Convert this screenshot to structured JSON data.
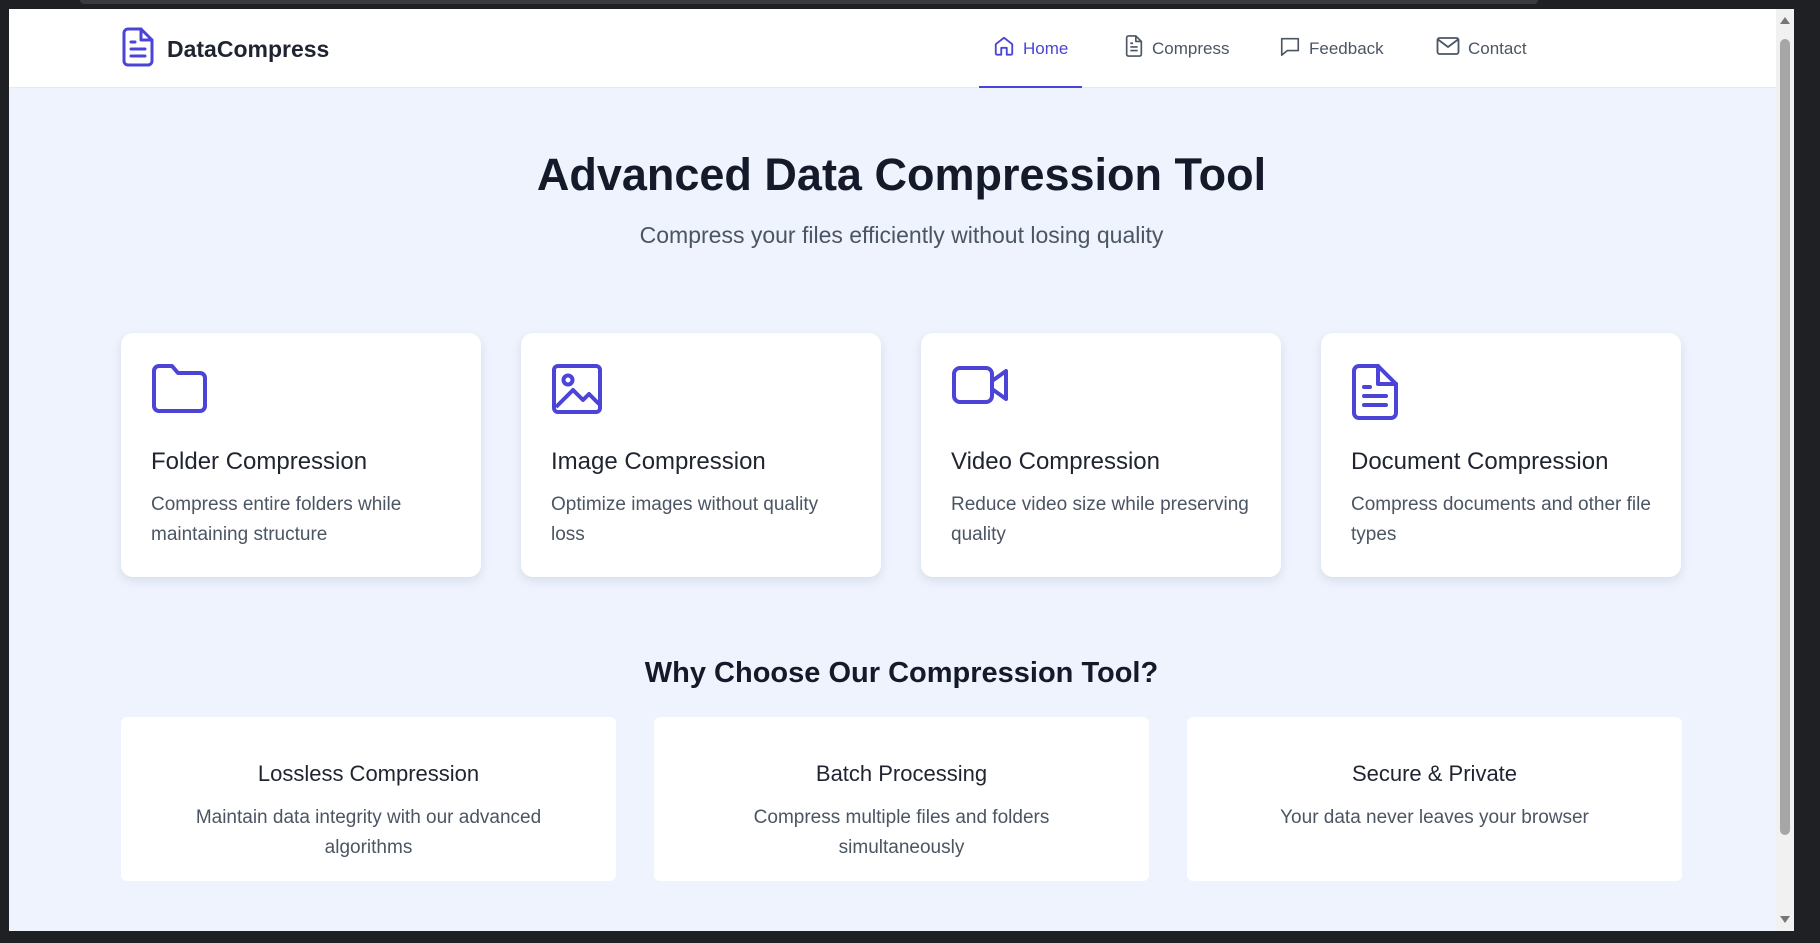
{
  "brand": {
    "name": "DataCompress"
  },
  "nav": {
    "items": [
      {
        "label": "Home",
        "icon": "home-icon",
        "active": true
      },
      {
        "label": "Compress",
        "icon": "document-icon",
        "active": false
      },
      {
        "label": "Feedback",
        "icon": "chat-icon",
        "active": false
      },
      {
        "label": "Contact",
        "icon": "mail-icon",
        "active": false
      }
    ]
  },
  "hero": {
    "title": "Advanced Data Compression Tool",
    "subtitle": "Compress your files efficiently without losing quality"
  },
  "cards": [
    {
      "title": "Folder Compression",
      "description": "Compress entire folders while maintaining structure",
      "icon": "folder-icon"
    },
    {
      "title": "Image Compression",
      "description": "Optimize images without quality loss",
      "icon": "image-icon"
    },
    {
      "title": "Video Compression",
      "description": "Reduce video size while preserving quality",
      "icon": "video-icon"
    },
    {
      "title": "Document Compression",
      "description": "Compress documents and other file types",
      "icon": "document-icon"
    }
  ],
  "why": {
    "title": "Why Choose Our Compression Tool?",
    "features": [
      {
        "title": "Lossless Compression",
        "description": "Maintain data integrity with our advanced algorithms"
      },
      {
        "title": "Batch Processing",
        "description": "Compress multiple files and folders simultaneously"
      },
      {
        "title": "Secure & Private",
        "description": "Your data never leaves your browser"
      }
    ]
  },
  "colors": {
    "accent": "#4b44d6",
    "background": "#eef3fd",
    "text": "#151a2b",
    "muted": "#4b5563"
  }
}
